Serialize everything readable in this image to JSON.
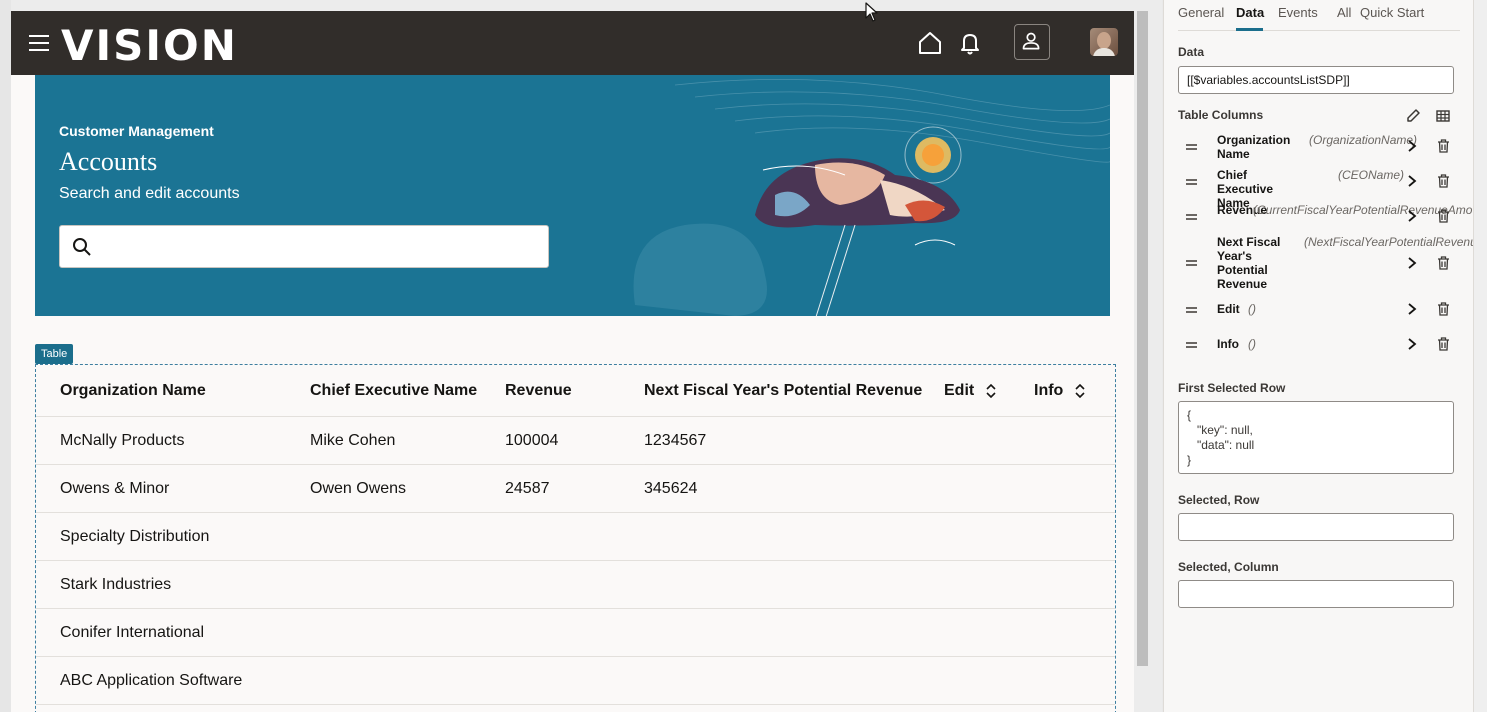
{
  "app": {
    "brand": "VISION",
    "icons": [
      "menu-icon",
      "home-icon",
      "bell-icon",
      "user-icon",
      "avatar"
    ]
  },
  "hero": {
    "eyebrow": "Customer Management",
    "title": "Accounts",
    "subtitle": "Search and edit accounts",
    "search_placeholder": "",
    "background_color": "#1b7494"
  },
  "table": {
    "tag": "Table",
    "columns": [
      "Organization Name",
      "Chief Executive Name",
      "Revenue",
      "Next Fiscal Year's Potential Revenue",
      "Edit",
      "Info"
    ],
    "rows": [
      [
        "McNally Products",
        "Mike Cohen",
        "100004",
        "1234567"
      ],
      [
        "Owens & Minor",
        "Owen Owens",
        "24587",
        "345624"
      ],
      [
        "Specialty Distribution",
        "",
        "",
        ""
      ],
      [
        "Stark Industries",
        "",
        "",
        ""
      ],
      [
        "Conifer International",
        "",
        "",
        ""
      ],
      [
        "ABC Application Software",
        "",
        "",
        ""
      ]
    ]
  },
  "panel": {
    "tabs": [
      "General",
      "Data",
      "Events",
      "All",
      "Quick Start"
    ],
    "active_tab": "Data",
    "data_label": "Data",
    "data_value": "[[$variables.accountsListSDP]]",
    "table_columns_label": "Table Columns",
    "table_columns": [
      {
        "name": "Organization Name",
        "field": "(OrganizationName)"
      },
      {
        "name": "Chief Executive Name",
        "field": "(CEOName)"
      },
      {
        "name": "Revenue",
        "field": "(CurrentFiscalYearPotentialRevenueAmount)"
      },
      {
        "name": "Next Fiscal Year's Potential Revenue",
        "field": "(NextFiscalYearPotentialRevenueAmount)"
      },
      {
        "name": "Edit",
        "field": "()"
      },
      {
        "name": "Info",
        "field": "()"
      }
    ],
    "first_selected_row_label": "First Selected Row",
    "first_selected_row_value": "{\n   \"key\": null,\n   \"data\": null\n}",
    "selected_row_label": "Selected, Row",
    "selected_row_value": "",
    "selected_column_label": "Selected, Column",
    "selected_column_value": "",
    "accent_color": "#1b6e8c"
  }
}
